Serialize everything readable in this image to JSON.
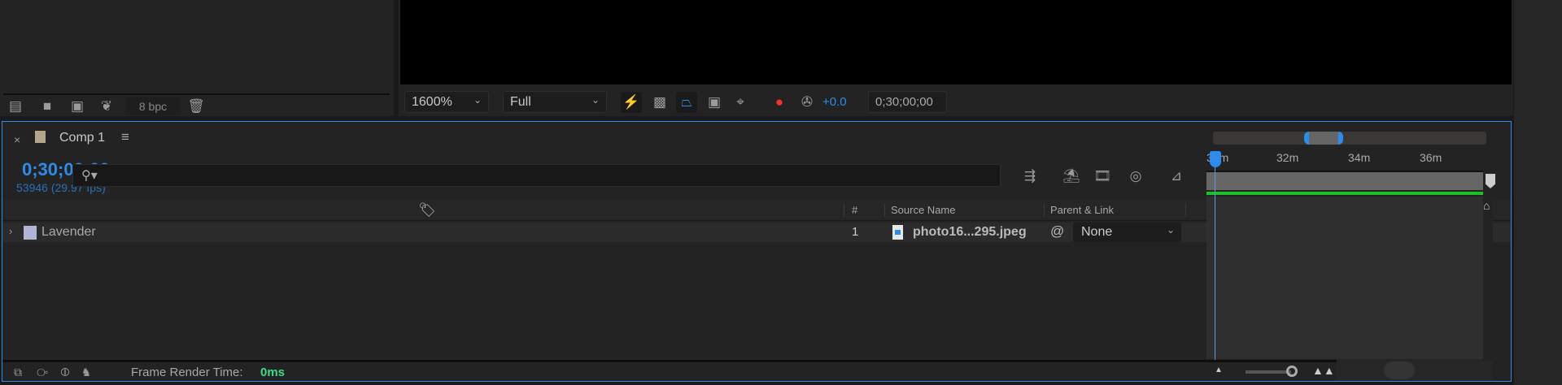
{
  "project_panel": {
    "bpc_label": "8 bpc",
    "icons": [
      "interpret-footage-icon",
      "new-folder-icon",
      "new-composition-icon",
      "flowchart-icon",
      "bpc",
      "trash-icon"
    ]
  },
  "viewer": {
    "zoom": "1600%",
    "resolution": "Full",
    "exposure": "+0.0",
    "timecode": "0;30;00;00"
  },
  "timeline": {
    "tab_label": "Comp 1",
    "current_time": "0;30;00;00",
    "frame_info": "53946 (29.97 fps)",
    "search_placeholder": "",
    "columns": {
      "number": "#",
      "source_name": "Source Name",
      "parent_link": "Parent & Link"
    },
    "layers": [
      {
        "name": "Lavender",
        "number": "1",
        "source": "photo16...295.jpeg",
        "parent": "None",
        "label_color": "#b3b3d9"
      }
    ],
    "ruler": [
      "30m",
      "32m",
      "34m",
      "36m"
    ],
    "frame_render_label": "Frame Render Time:",
    "frame_render_value": "0ms"
  },
  "colors": {
    "accent": "#2d8ceb",
    "comp_label": "#b5a58a",
    "render_time": "#3ddc84",
    "work_area": "#1fbf2a"
  }
}
